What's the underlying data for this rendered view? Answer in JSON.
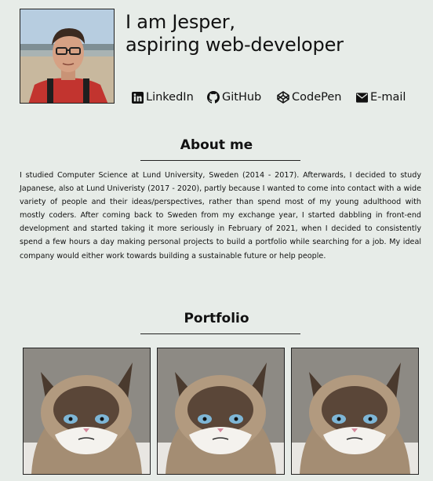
{
  "profile": {
    "headline_line1": "I am Jesper,",
    "headline_line2": "aspiring web-developer",
    "avatar_alt": "Jesper"
  },
  "links": [
    {
      "label": "LinkedIn",
      "icon": "linkedin-icon"
    },
    {
      "label": "GitHub",
      "icon": "github-icon"
    },
    {
      "label": "CodePen",
      "icon": "codepen-icon"
    },
    {
      "label": "E-mail",
      "icon": "envelope-icon"
    }
  ],
  "about": {
    "title": "About me",
    "text": "I studied Computer Science at Lund University, Sweden (2014 - 2017). Afterwards, I decided to study Japanese, also at Lund Univeristy (2017 - 2020), partly because I wanted to come into contact with a wide variety of people and their ideas/perspectives, rather than spend most of my young adulthood with mostly coders. After coming back to Sweden from my exchange year, I started dabbling in front-end development and started taking it more seriously in February of 2021, when I decided to consistently spend a few hours a day making personal projects to build a portfolio while searching for a job. My ideal company would either work towards building a sustainable future or help people."
  },
  "portfolio": {
    "title": "Portfolio",
    "items": [
      {
        "image": "grumpy-cat"
      },
      {
        "image": "grumpy-cat"
      },
      {
        "image": "grumpy-cat"
      }
    ]
  },
  "colors": {
    "background": "#e7ece8",
    "text": "#111111"
  }
}
